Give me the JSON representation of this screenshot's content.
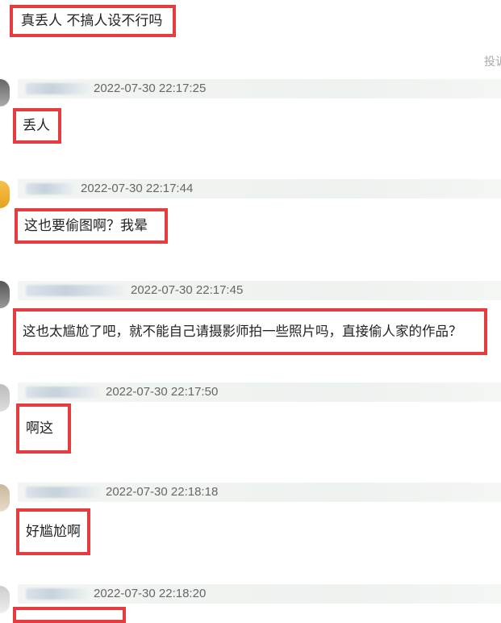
{
  "top_comment": {
    "text": "真丢人 不搞人设不行吗"
  },
  "report_label": "投诉",
  "comments": [
    {
      "timestamp": "2022-07-30 22:17:25",
      "text": "丢人"
    },
    {
      "timestamp": "2022-07-30 22:17:44",
      "text": "这也要偷图啊？我晕"
    },
    {
      "timestamp": "2022-07-30 22:17:45",
      "text": "这也太尴尬了吧，就不能自己请摄影师拍一些照片吗，直接偷人家的作品？"
    },
    {
      "timestamp": "2022-07-30 22:17:50",
      "text": "啊这"
    },
    {
      "timestamp": "2022-07-30 22:18:18",
      "text": "好尴尬啊"
    },
    {
      "timestamp": "2022-07-30 22:18:20",
      "text": ""
    }
  ],
  "colors": {
    "highlight_border": "#e63b3f",
    "meta_bar": "#eef2ef",
    "timestamp": "#666666"
  }
}
